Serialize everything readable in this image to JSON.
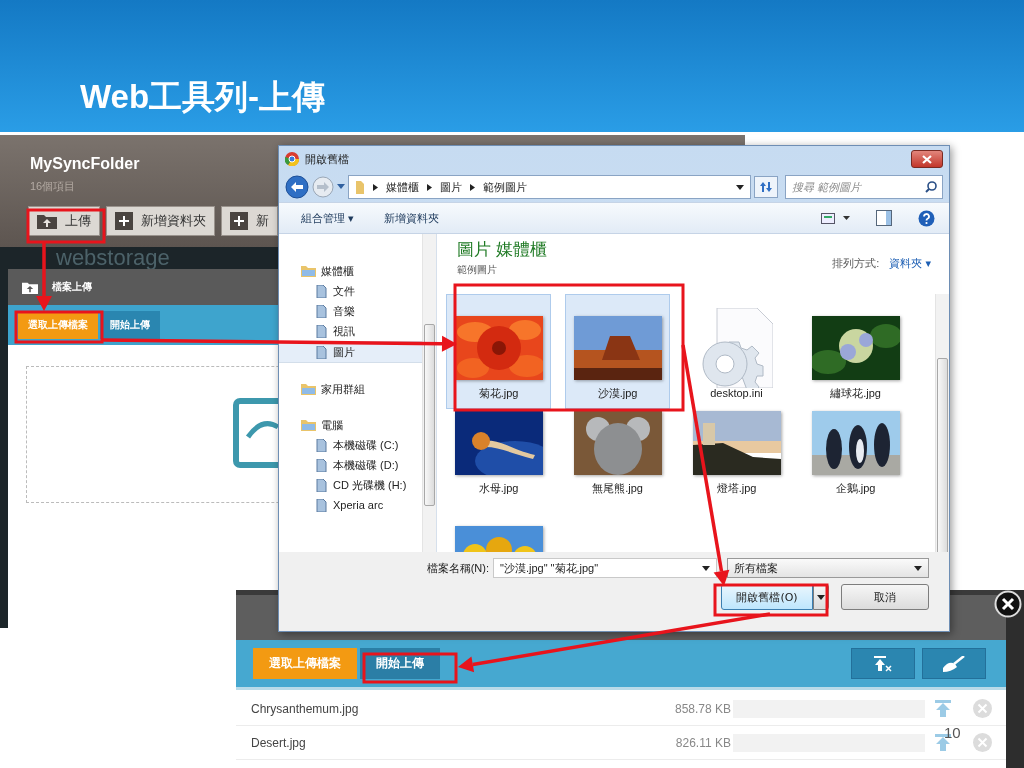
{
  "slide": {
    "title": "Web工具列-上傳",
    "page_number": "10"
  },
  "folder_window": {
    "title": "MySyncFolder",
    "item_count": "16個項目",
    "toolbar": [
      "上傳",
      "新增資料夾",
      "新"
    ],
    "logo": "webstorage",
    "upload_panel": {
      "title": "檔案上傳",
      "buttons": [
        {
          "label": "選取上傳檔案",
          "selected": true
        },
        {
          "label": "開始上傳",
          "selected": false
        }
      ]
    }
  },
  "open_dialog": {
    "title": "開啟舊檔",
    "breadcrumb": [
      "媒體櫃",
      "圖片",
      "範例圖片"
    ],
    "search": {
      "placeholder": "搜尋 範例圖片"
    },
    "toolbar": [
      "組合管理 ▾",
      "新增資料夾"
    ],
    "nav": [
      {
        "label": "媒體櫃",
        "selected": false,
        "children": [
          {
            "label": "文件",
            "selected": false
          },
          {
            "label": "音樂",
            "selected": false
          },
          {
            "label": "視訊",
            "selected": false
          },
          {
            "label": "圖片",
            "selected": true
          }
        ]
      },
      {
        "label": "家用群組",
        "selected": false
      },
      {
        "label": "電腦",
        "selected": false,
        "children": [
          {
            "label": "本機磁碟 (C:)",
            "selected": false
          },
          {
            "label": "本機磁碟 (D:)",
            "selected": false
          },
          {
            "label": "CD 光碟機 (H:)",
            "selected": false
          },
          {
            "label": "Xperia arc",
            "selected": false
          }
        ]
      }
    ],
    "library_title": "圖片 媒體櫃",
    "library_subtitle": "範例圖片",
    "arrange_label": "排列方式:",
    "arrange_value": "資料夾 ▾",
    "files": [
      {
        "name": "菊花.jpg",
        "kind": "picture",
        "selected": true
      },
      {
        "name": "沙漠.jpg",
        "kind": "picture",
        "selected": true
      },
      {
        "name": "desktop.ini",
        "kind": "file",
        "selected": false
      },
      {
        "name": "繡球花.jpg",
        "kind": "picture",
        "selected": false
      },
      {
        "name": "水母.jpg",
        "kind": "picture",
        "selected": false
      },
      {
        "name": "無尾熊.jpg",
        "kind": "picture",
        "selected": false
      },
      {
        "name": "燈塔.jpg",
        "kind": "picture",
        "selected": false
      },
      {
        "name": "企鵝.jpg",
        "kind": "picture",
        "selected": false
      },
      {
        "kind": "picture",
        "selected": false
      }
    ],
    "filename_label": "檔案名稱(N):",
    "filename_value": "\"沙漠.jpg\" \"菊花.jpg\"",
    "filetype": "所有檔案",
    "buttons": [
      "開啟舊檔(O)",
      "取消"
    ]
  },
  "upload_window": {
    "buttons": [
      {
        "label": "選取上傳檔案",
        "selected": true
      },
      {
        "label": "開始上傳",
        "selected": false
      }
    ],
    "rows": [
      {
        "name": "Chrysanthemum.jpg",
        "size": "858.78 KB",
        "level": 0
      },
      {
        "name": "Desert.jpg",
        "size": "826.11 KB",
        "level": 0
      }
    ]
  }
}
